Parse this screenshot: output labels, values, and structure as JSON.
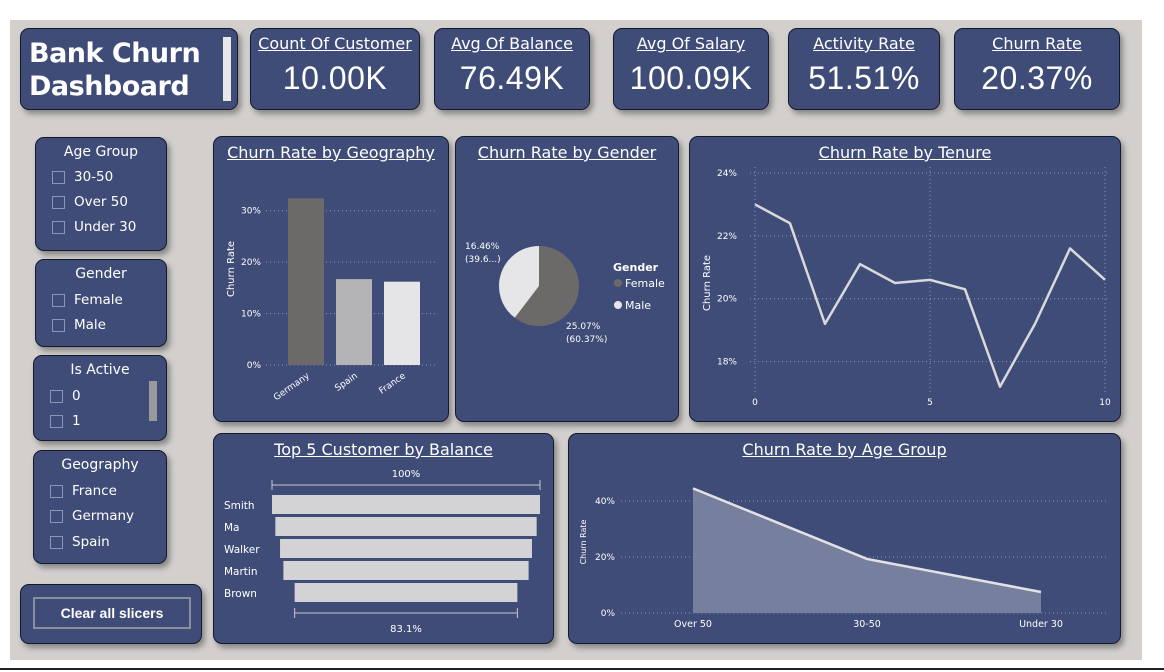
{
  "title": "Bank Churn\nDashboard",
  "kpis": [
    {
      "label": "Count Of Customer",
      "value": "10.00K"
    },
    {
      "label": "Avg Of Balance",
      "value": "76.49K"
    },
    {
      "label": "Avg Of Salary",
      "value": "100.09K"
    },
    {
      "label": "Activity Rate",
      "value": "51.51%"
    },
    {
      "label": "Churn Rate",
      "value": "20.37%"
    }
  ],
  "slicers": [
    {
      "title": "Age Group",
      "items": [
        "30-50",
        "Over 50",
        "Under 30"
      ]
    },
    {
      "title": "Gender",
      "items": [
        "Female",
        "Male"
      ]
    },
    {
      "title": "Is Active",
      "items": [
        "0",
        "1"
      ]
    },
    {
      "title": "Geography",
      "items": [
        "France",
        "Germany",
        "Spain"
      ]
    }
  ],
  "clear_button": "Clear all slicers",
  "colors": {
    "card": "#3f4c78",
    "canvas": "#d2cfcd",
    "germany_bar": "#6b6a69",
    "spain_bar": "#b4b3b6",
    "france_bar": "#e5e5e7"
  },
  "chart_data": [
    {
      "type": "bar",
      "title": "Churn Rate by Geography",
      "ylabel": "Churn Rate",
      "categories": [
        "Germany",
        "Spain",
        "France"
      ],
      "values": [
        32.4,
        16.7,
        16.2
      ],
      "ylim": [
        0,
        35
      ],
      "yticks": [
        "0%",
        "10%",
        "20%",
        "30%"
      ],
      "grid": true
    },
    {
      "type": "pie",
      "title": "Churn Rate by Gender",
      "legend_title": "Gender",
      "legend_position": "right",
      "slices": [
        {
          "name": "Female",
          "value": 25.07,
          "label": "25.07%",
          "sublabel": "(60.37%)",
          "share": 60.37
        },
        {
          "name": "Male",
          "value": 16.46,
          "label": "16.46%",
          "sublabel": "(39.6...)",
          "share": 39.63
        }
      ]
    },
    {
      "type": "line",
      "title": "Churn Rate by Tenure",
      "ylabel": "Churn Rate",
      "x": [
        0,
        1,
        2,
        3,
        4,
        5,
        6,
        7,
        8,
        9,
        10
      ],
      "values": [
        23.0,
        22.4,
        19.2,
        21.1,
        20.5,
        20.6,
        20.3,
        17.2,
        19.2,
        21.6,
        20.6
      ],
      "ylim": [
        17,
        24
      ],
      "yticks": [
        "18%",
        "20%",
        "22%",
        "24%"
      ],
      "xticks": [
        "0",
        "5",
        "10"
      ],
      "grid": true
    },
    {
      "type": "bar",
      "title": "Top 5 Customer by Balance",
      "categories": [
        "Smith",
        "Ma",
        "Walker",
        "Martin",
        "Brown"
      ],
      "values": [
        100,
        97.5,
        94,
        91.5,
        83.1
      ],
      "top_label": "100%",
      "bottom_label": "83.1%"
    },
    {
      "type": "area",
      "title": "Churn Rate by Age Group",
      "ylabel": "Churn Rate",
      "categories": [
        "Over 50",
        "30-50",
        "Under 30"
      ],
      "values": [
        44.5,
        19.3,
        7.5
      ],
      "ylim": [
        0,
        50
      ],
      "yticks": [
        "0%",
        "20%",
        "40%"
      ],
      "grid": true
    }
  ]
}
